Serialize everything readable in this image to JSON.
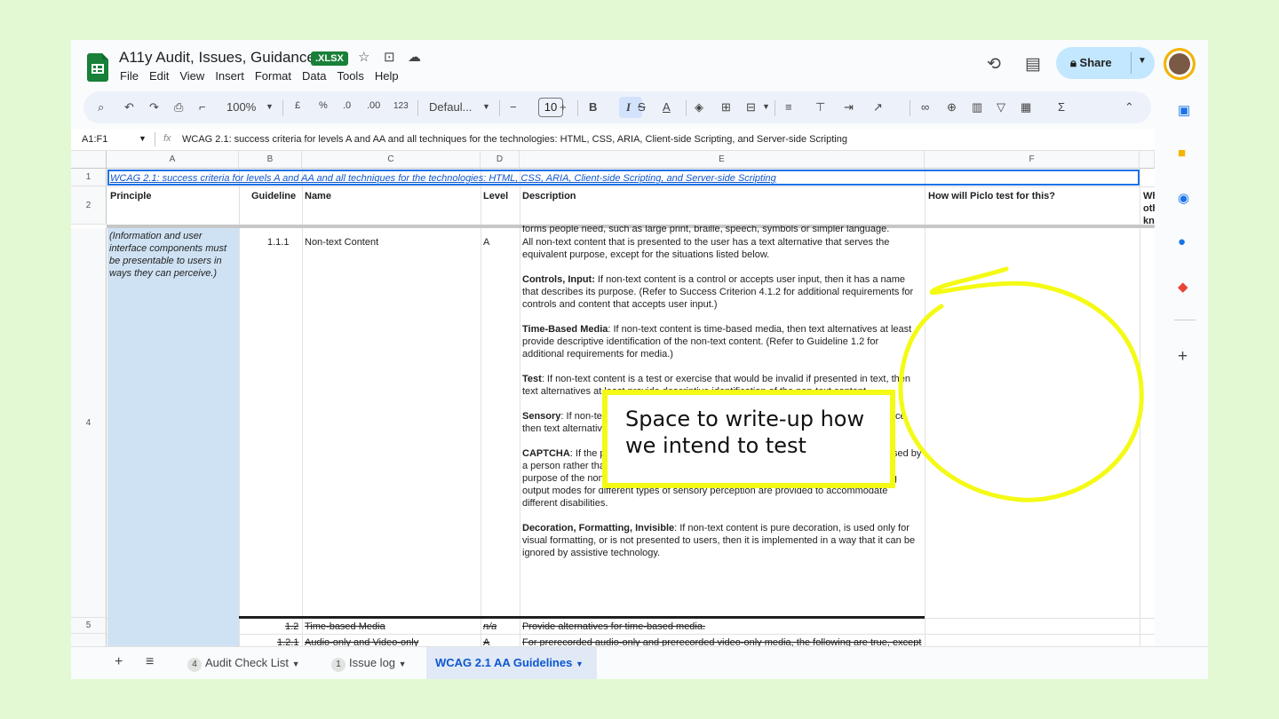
{
  "header": {
    "title": "A11y Audit, Issues, Guidance",
    "badge": ".XLSX",
    "menu": [
      "File",
      "Edit",
      "View",
      "Insert",
      "Format",
      "Data",
      "Tools",
      "Help"
    ],
    "share_label": "Share"
  },
  "toolbar": {
    "zoom": "100%",
    "currency": "£",
    "percent": "%",
    "dec_dec": ".0",
    "dec_inc": ".00",
    "number_format": "123",
    "font": "Defaul...",
    "font_size": "10",
    "bold": "B",
    "italic": "I",
    "strike": "S",
    "textcolor": "A"
  },
  "formula_bar": {
    "cell_ref": "A1:F1",
    "fx": "fx",
    "value": "WCAG 2.1: success criteria for levels A and AA and all techniques for the technologies: HTML, CSS, ARIA, Client-side Scripting, and Server-side Scripting"
  },
  "columns": [
    "A",
    "B",
    "C",
    "D",
    "E",
    "F"
  ],
  "rows": [
    "1",
    "2",
    "4",
    "5"
  ],
  "sheet": {
    "title": "WCAG 2.1: success criteria for levels A and AA and all techniques for the technologies: HTML, CSS, ARIA, Client-side Scripting, and Server-side Scripting",
    "headers": {
      "principle": "Principle",
      "guideline": "Guideline",
      "name": "Name",
      "level": "Level",
      "description": "Description",
      "piclo": "How will Piclo test for this?",
      "g_partial": "Wh",
      "g_partial2": "oth",
      "g_partial3": "kn"
    },
    "row4": {
      "principle": "(Information and user interface components must be presentable to users in ways they can perceive.)",
      "guideline": "1.1.1",
      "name": "Non-text Content",
      "level": "A",
      "desc_top": "forms people need, such as large print, braille, speech, symbols or simpler language.",
      "desc_intro": "All non-text content that is presented to the user has a text alternative that serves the equivalent purpose, except for the situations listed below.",
      "controls_label": "Controls, Input:",
      "controls_text": " If non-text content is a control or accepts user input, then it has a name that describes its purpose. (Refer to Success Criterion 4.1.2 for additional requirements for controls and content that accepts user input.)",
      "time_label": "Time-Based Media",
      "time_text": ": If non-text content is time-based media, then text alternatives at least provide descriptive identification of the non-text content. (Refer to Guideline 1.2 for additional requirements for media.)",
      "test_label": "Test",
      "test_text": ": If non-text content is a test or exercise that would be invalid if presented in text, then text alternatives at least provide descriptive identification of the non-text content.",
      "sensory_label": "Sensory",
      "sensory_text": ": If non-text content is primarily intended to create a specific sensory experience, then text alternatives at least provide descriptive identification of the non-text content.",
      "captcha_label": "CAPTCHA",
      "captcha_text": ": If the purpose of non-text content is to confirm that content is being accessed by a person rather than a computer, then text alternatives that identify and describe the purpose of the non-text content are provided, and alternative forms of CAPTCHA using output modes for different types of sensory perception are provided to accommodate different disabilities.",
      "deco_label": "Decoration, Formatting, Invisible",
      "deco_text": ": If non-text content is pure decoration, is used only for visual formatting, or is not presented to users, then it is implemented in a way that it can be ignored by assistive technology."
    },
    "row5": {
      "guideline": "1.2",
      "name": "Time-based Media",
      "level": "n/a",
      "description": "Provide alternatives for time-based media."
    },
    "row6": {
      "guideline": "1.2.1",
      "name": "Audio-only and Video-only (Prerecorded)",
      "level": "A",
      "description": "For prerecorded audio-only and prerecorded video-only media, the following are true, except when the audio or video is a media alternative for text and is clearly labeled as such:"
    }
  },
  "tabs": {
    "add": "+",
    "list": "≡",
    "tab1_badge": "4",
    "tab1": "Audit Check List",
    "tab2_badge": "1",
    "tab2": "Issue log",
    "tab3": "WCAG 2.1 AA Guidelines"
  },
  "callout": {
    "text": "Space to write-up how we intend to test"
  },
  "colors": {
    "background": "#e3f9d4",
    "highlight": "#f4fa14",
    "principle_fill": "#cfe2f3",
    "accent": "#1a73e8",
    "share_bg": "#c2e7ff"
  },
  "icons": [
    "star-icon",
    "move-folder-icon",
    "cloud-status-icon",
    "history-icon",
    "comment-icon",
    "lock-icon",
    "search-icon",
    "undo-icon",
    "redo-icon",
    "print-icon",
    "paint-format-icon"
  ]
}
